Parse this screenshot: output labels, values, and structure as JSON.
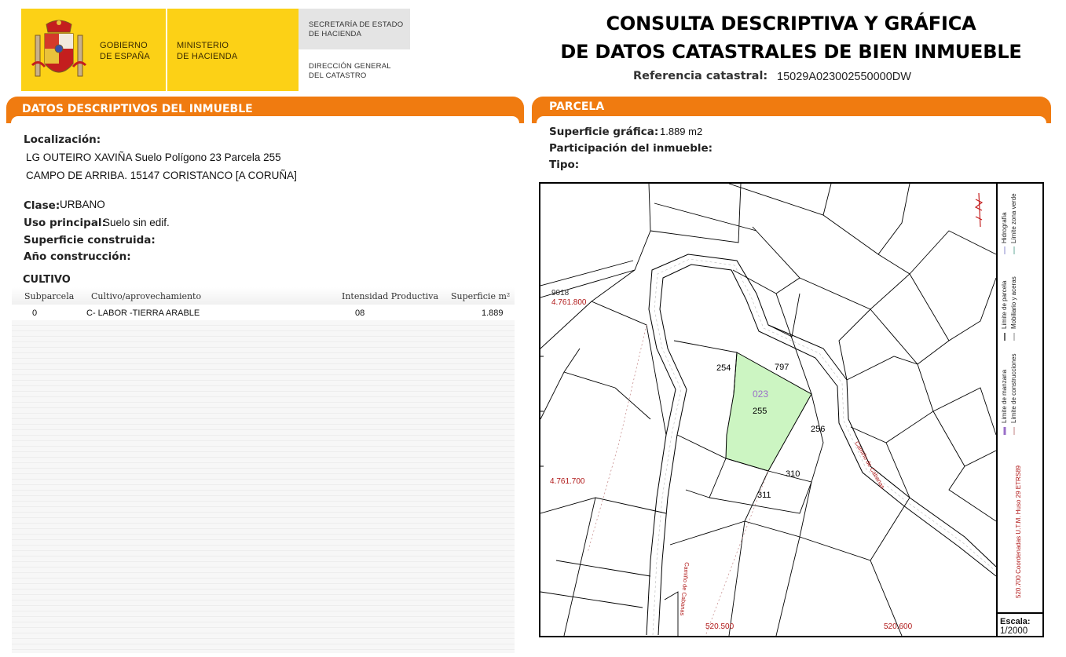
{
  "header": {
    "logo_gov": "GOBIERNO\nDE ESPAÑA",
    "logo_min": "MINISTERIO\nDE HACIENDA",
    "logo_sec": "SECRETARÍA DE ESTADO\nDE HACIENDA",
    "logo_dir": "DIRECCIÓN GENERAL\nDEL CATASTRO",
    "title": "CONSULTA DESCRIPTIVA Y GRÁFICA\nDE DATOS CATASTRALES DE BIEN INMUEBLE",
    "ref_label": "Referencia catastral:",
    "ref_value": "15029A023002550000DW"
  },
  "left": {
    "section_title": "DATOS DESCRIPTIVOS DEL INMUEBLE",
    "loc_label": "Localización:",
    "loc_line1": "LG OUTEIRO XAVIÑA  Suelo Polígono 23 Parcela 255",
    "loc_line2": "CAMPO DE ARRIBA. 15147 CORISTANCO [A CORUÑA]",
    "clase_label": "Clase:",
    "clase_value": "URBANO",
    "uso_label": "Uso principal:",
    "uso_value": "Suelo sin edif.",
    "sup_const_label": "Superficie construida:",
    "anio_label": "Año construcción:",
    "cultivo_title": "CULTIVO",
    "columns": [
      "Subparcela",
      "Cultivo/aprovechamiento",
      "Intensidad Productiva",
      "Superficie m²"
    ],
    "rows": [
      {
        "subparcela": "0",
        "cultivo": "C- LABOR -TIERRA ARABLE",
        "intensidad": "08",
        "superficie": "1.889"
      }
    ]
  },
  "right": {
    "section_title": "PARCELA",
    "sup_label": "Superficie gráfica:",
    "sup_value": "1.889 m2",
    "part_label": "Participación del inmueble:",
    "tipo_label": "Tipo:",
    "map": {
      "coord_top_left_a": "9018",
      "coord_top_left_b": "4.761.800",
      "coord_mid_left": "4.761.700",
      "coord_bottom_a": "520.500",
      "coord_bottom_b": "520.600",
      "parcel_main": "255",
      "parcel_poly": "023",
      "parcels": [
        "254",
        "797",
        "256",
        "310",
        "311"
      ],
      "road_label": "Camiño de Cabanas",
      "road_label_2": "Camiño de Cabanas",
      "parcel_fill": "#ccf5c2"
    },
    "legend": {
      "items": [
        "Límite de manzana",
        "Límite de parcela",
        "Límite de construcciones",
        "Mobiliario y aceras",
        "Límite zona verde",
        "Hidrografía"
      ],
      "coords": "520.700 Coordenadas U.T.M. Huso 29 ETRS89"
    },
    "scale_label": "Escala:",
    "scale_value": "1/2000"
  },
  "colors": {
    "accent": "#f07b10",
    "logo_yellow": "#fcd116",
    "coord_red": "#b01818"
  }
}
